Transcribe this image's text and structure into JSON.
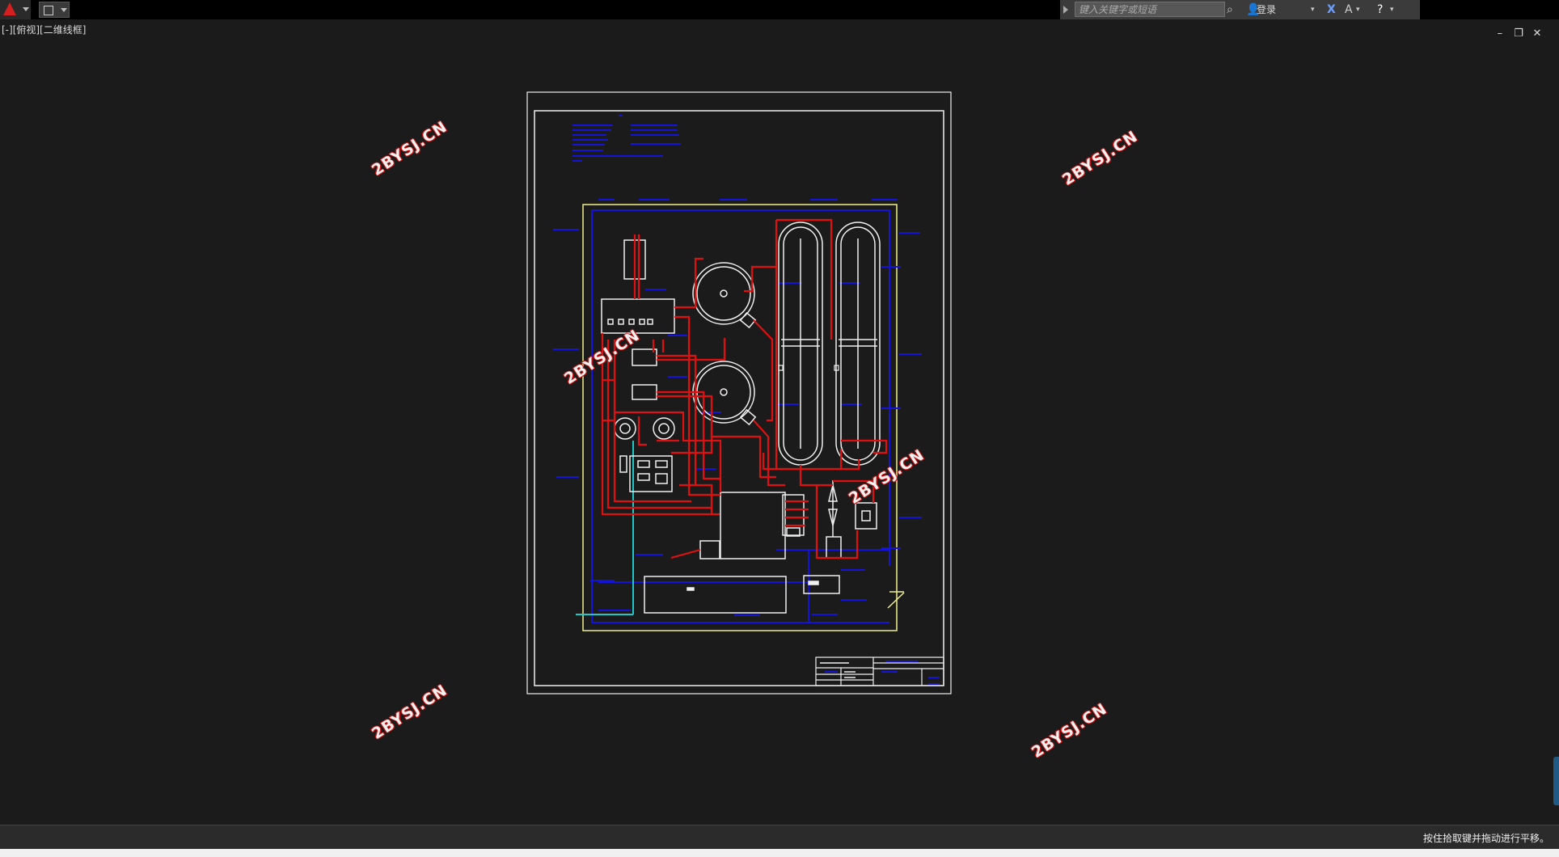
{
  "toolbar": {
    "app_icon": "autocad-logo-icon",
    "search_placeholder": "键入关键字或短语",
    "login_label": "登录"
  },
  "viewport": {
    "label": "[-][俯视][二维线框]"
  },
  "window_controls": {
    "minimize": "–",
    "restore": "❐",
    "close": "✕"
  },
  "status": {
    "message": "按住拾取键并拖动进行平移。"
  },
  "watermarks": [
    "2BYSJ.CN",
    "2BYSJ.CN",
    "2BYSJ.CN",
    "2BYSJ.CN",
    "2BYSJ.CN",
    "2BYSJ.CN"
  ],
  "colors": {
    "canvas": "#1b1b1b",
    "pipe_red": "#e01010",
    "outline_white": "#f0f0f0",
    "annotation_blue": "#1414d8",
    "boundary_yellow": "#f0f08c",
    "accent_cyan": "#20c8c8"
  }
}
